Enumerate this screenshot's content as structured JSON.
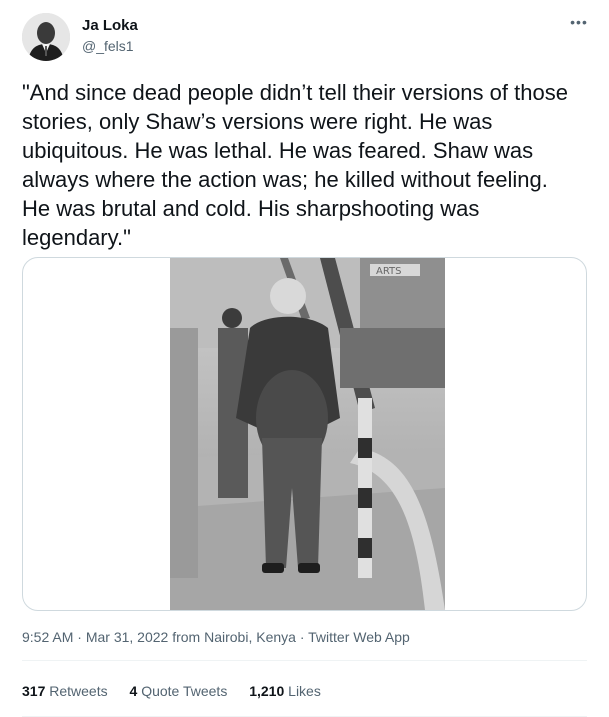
{
  "author": {
    "name": "Ja Loka",
    "handle": "@_fels1",
    "more_icon": "more-horizontal-icon"
  },
  "tweet": {
    "text": "\"And since dead people didn’t tell their versions of those stories, only Shaw’s versions were right. He was ubiquitous. He was lethal. He was feared. Shaw was always where the action was; he killed without feeling. He was brutal and cold. His sharpshooting was legendary.\""
  },
  "media": {
    "sign_text": "ARTS"
  },
  "meta": {
    "time": "9:52 AM",
    "separator1": "·",
    "date": "Mar 31, 2022 from Nairobi, Kenya",
    "separator2": "·",
    "app": "Twitter Web App"
  },
  "stats": {
    "retweets_count": "317",
    "retweets_label": "Retweets",
    "quotes_count": "4",
    "quotes_label": "Quote Tweets",
    "likes_count": "1,210",
    "likes_label": "Likes"
  },
  "colors": {
    "text_primary": "#0f1419",
    "text_secondary": "#536471",
    "border": "#cfd9de"
  }
}
